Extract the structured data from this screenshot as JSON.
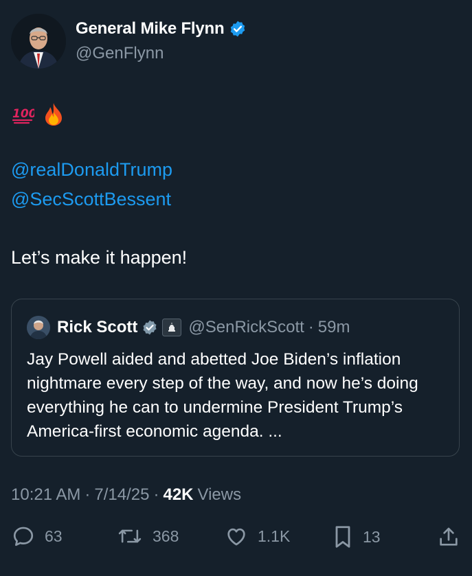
{
  "author": {
    "name": "General Mike Flynn",
    "handle": "@GenFlynn",
    "avatar_icon": "portrait-avatar-icon",
    "verified_color": "#1d9bf0"
  },
  "tweet": {
    "emojis": [
      "hundred-points-emoji",
      "fire-emoji"
    ],
    "mentions": [
      "@realDonaldTrump",
      "@SecScottBessent"
    ],
    "text": "Let’s make it happen!",
    "mention_color": "#1d9bf0"
  },
  "quote": {
    "name": "Rick Scott",
    "handle": "@SenRickScott",
    "separator": "·",
    "time": "59m",
    "affiliation_icon": "capitol-building-icon",
    "text": "Jay Powell aided and abetted Joe Biden’s inflation nightmare every step of the way, and now he’s doing everything he can to undermine President Trump’s America-first economic agenda. ..."
  },
  "meta": {
    "time": "10:21 AM",
    "sep1": "·",
    "date": "7/14/25",
    "sep2": "·",
    "views_count": "42K",
    "views_label": "Views"
  },
  "actions": {
    "replies": "63",
    "reposts": "368",
    "likes": "1.1K",
    "bookmarks": "13",
    "icons": [
      "reply-icon",
      "repost-icon",
      "like-icon",
      "bookmark-icon",
      "share-icon"
    ]
  },
  "colors": {
    "background": "#15202b",
    "secondary_text": "#8b98a5",
    "border": "#38444d"
  }
}
